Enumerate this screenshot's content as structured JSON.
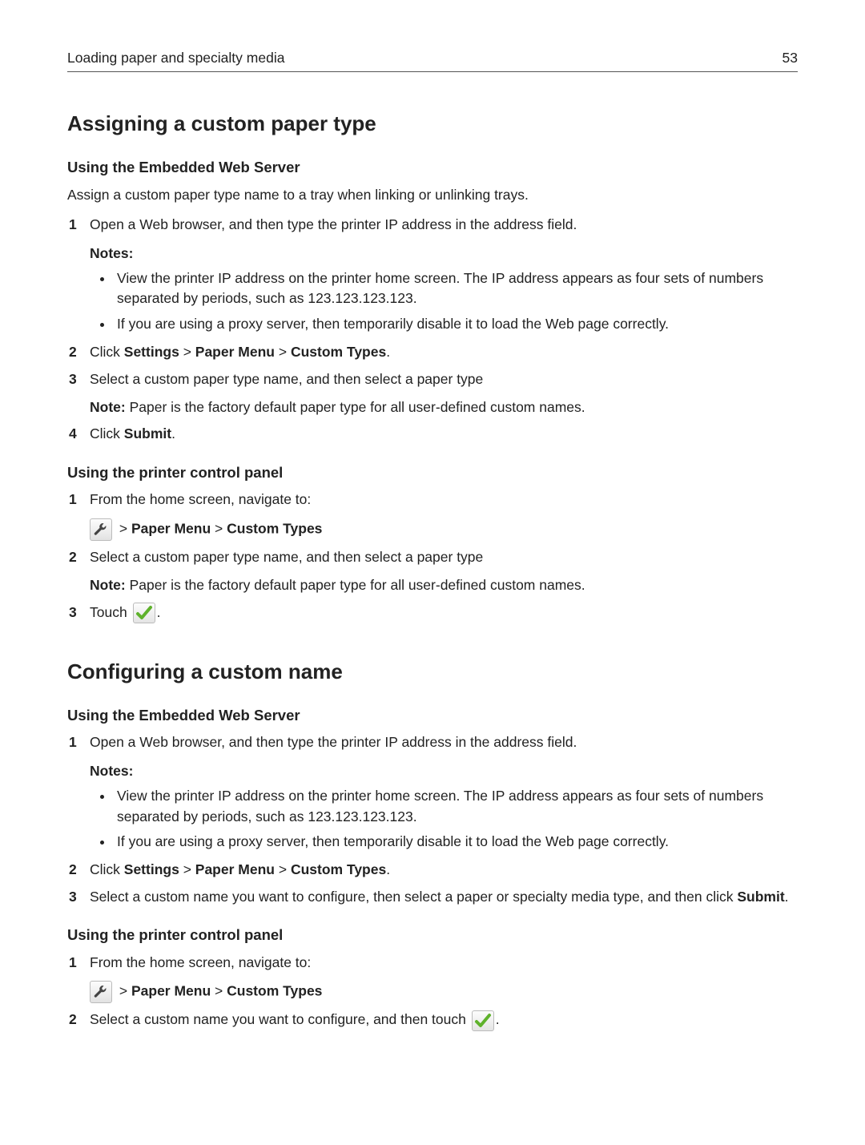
{
  "page": {
    "chapter": "Loading paper and specialty media",
    "number": "53"
  },
  "s1": {
    "title": "Assigning a custom paper type",
    "web": {
      "heading": "Using the Embedded Web Server",
      "intro": "Assign a custom paper type name to a tray when linking or unlinking trays.",
      "step1": "Open a Web browser, and then type the printer IP address in the address field.",
      "notes_label": "Notes:",
      "note1": "View the printer IP address on the printer home screen. The IP address appears as four sets of numbers separated by periods, such as 123.123.123.123.",
      "note2": "If you are using a proxy server, then temporarily disable it to load the Web page correctly.",
      "step2_prefix": "Click ",
      "step2_a": "Settings",
      "step2_sep": " > ",
      "step2_b": "Paper Menu",
      "step2_c": "Custom Types",
      "step2_suffix": ".",
      "step3": "Select a custom paper type name, and then select a paper type",
      "step3_note_prefix": "Note: ",
      "step3_note": "Paper is the factory default paper type for all user-defined custom names.",
      "step4_prefix": "Click ",
      "step4_a": "Submit",
      "step4_suffix": "."
    },
    "panel": {
      "heading": "Using the printer control panel",
      "step1": "From the home screen, navigate to:",
      "nav_sep": " > ",
      "nav_a": "Paper Menu",
      "nav_b": "Custom Types",
      "step2": "Select a custom paper type name, and then select a paper type",
      "step2_note_prefix": "Note: ",
      "step2_note": "Paper is the factory default paper type for all user-defined custom names.",
      "step3_prefix": "Touch ",
      "step3_suffix": "."
    }
  },
  "s2": {
    "title": "Configuring a custom name",
    "web": {
      "heading": "Using the Embedded Web Server",
      "step1": "Open a Web browser, and then type the printer IP address in the address field.",
      "notes_label": "Notes:",
      "note1": "View the printer IP address on the printer home screen. The IP address appears as four sets of numbers separated by periods, such as 123.123.123.123.",
      "note2": "If you are using a proxy server, then temporarily disable it to load the Web page correctly.",
      "step2_prefix": "Click ",
      "step2_a": "Settings",
      "step2_sep": " > ",
      "step2_b": "Paper Menu",
      "step2_c": "Custom Types",
      "step2_suffix": ".",
      "step3_prefix": "Select a custom name you want to configure, then select a paper or specialty media type, and then click ",
      "step3_a": "Submit",
      "step3_suffix": "."
    },
    "panel": {
      "heading": "Using the printer control panel",
      "step1": "From the home screen, navigate to:",
      "nav_sep": " > ",
      "nav_a": "Paper Menu",
      "nav_b": "Custom Types",
      "step2_prefix": "Select a custom name you want to configure, and then touch ",
      "step2_suffix": "."
    }
  }
}
